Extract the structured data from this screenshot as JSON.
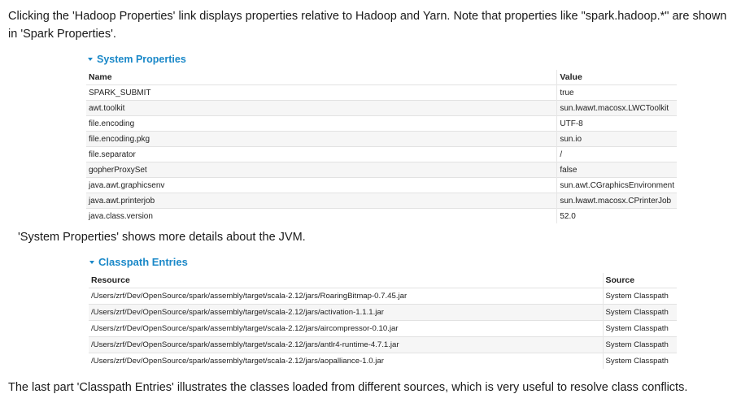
{
  "paragraphs": {
    "p1": "Clicking the 'Hadoop Properties' link displays properties relative to Hadoop and Yarn. Note that properties like \"spark.hadoop.*\" are shown in 'Spark Properties'.",
    "p2": "'System Properties' shows more details about the JVM.",
    "p3": "The last part 'Classpath Entries' illustrates the classes loaded from different sources, which is very useful to resolve class conflicts."
  },
  "system_properties": {
    "title": "System Properties",
    "headers": [
      "Name",
      "Value"
    ],
    "rows": [
      [
        "SPARK_SUBMIT",
        "true"
      ],
      [
        "awt.toolkit",
        "sun.lwawt.macosx.LWCToolkit"
      ],
      [
        "file.encoding",
        "UTF-8"
      ],
      [
        "file.encoding.pkg",
        "sun.io"
      ],
      [
        "file.separator",
        "/"
      ],
      [
        "gopherProxySet",
        "false"
      ],
      [
        "java.awt.graphicsenv",
        "sun.awt.CGraphicsEnvironment"
      ],
      [
        "java.awt.printerjob",
        "sun.lwawt.macosx.CPrinterJob"
      ],
      [
        "java.class.version",
        "52.0"
      ]
    ]
  },
  "classpath_entries": {
    "title": "Classpath Entries",
    "headers": [
      "Resource",
      "Source"
    ],
    "rows": [
      [
        "/Users/zrf/Dev/OpenSource/spark/assembly/target/scala-2.12/jars/RoaringBitmap-0.7.45.jar",
        "System Classpath"
      ],
      [
        "/Users/zrf/Dev/OpenSource/spark/assembly/target/scala-2.12/jars/activation-1.1.1.jar",
        "System Classpath"
      ],
      [
        "/Users/zrf/Dev/OpenSource/spark/assembly/target/scala-2.12/jars/aircompressor-0.10.jar",
        "System Classpath"
      ],
      [
        "/Users/zrf/Dev/OpenSource/spark/assembly/target/scala-2.12/jars/antlr4-runtime-4.7.1.jar",
        "System Classpath"
      ],
      [
        "/Users/zrf/Dev/OpenSource/spark/assembly/target/scala-2.12/jars/aopalliance-1.0.jar",
        "System Classpath"
      ]
    ]
  },
  "colors": {
    "accent": "#1a88c8"
  }
}
